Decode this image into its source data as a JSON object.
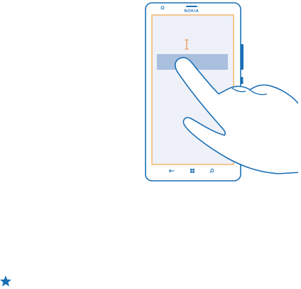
{
  "phone": {
    "brand_label": "NOKIA"
  },
  "colors": {
    "outline": "#1a6fb4",
    "phone_side_button": "#1a6fb4",
    "screen_background": "#eef1f8",
    "screen_border": "#f3a64a",
    "text_cursor": "#e8812c",
    "selection_highlight": "#a9bfde",
    "star": "#1a6fb4"
  },
  "icons": {
    "phone": "smartphone-icon",
    "hand": "pointing-hand-icon",
    "cursor": "text-cursor-icon",
    "back": "back-arrow-icon",
    "start": "windows-start-icon",
    "search": "search-icon",
    "tip": "star-icon"
  }
}
